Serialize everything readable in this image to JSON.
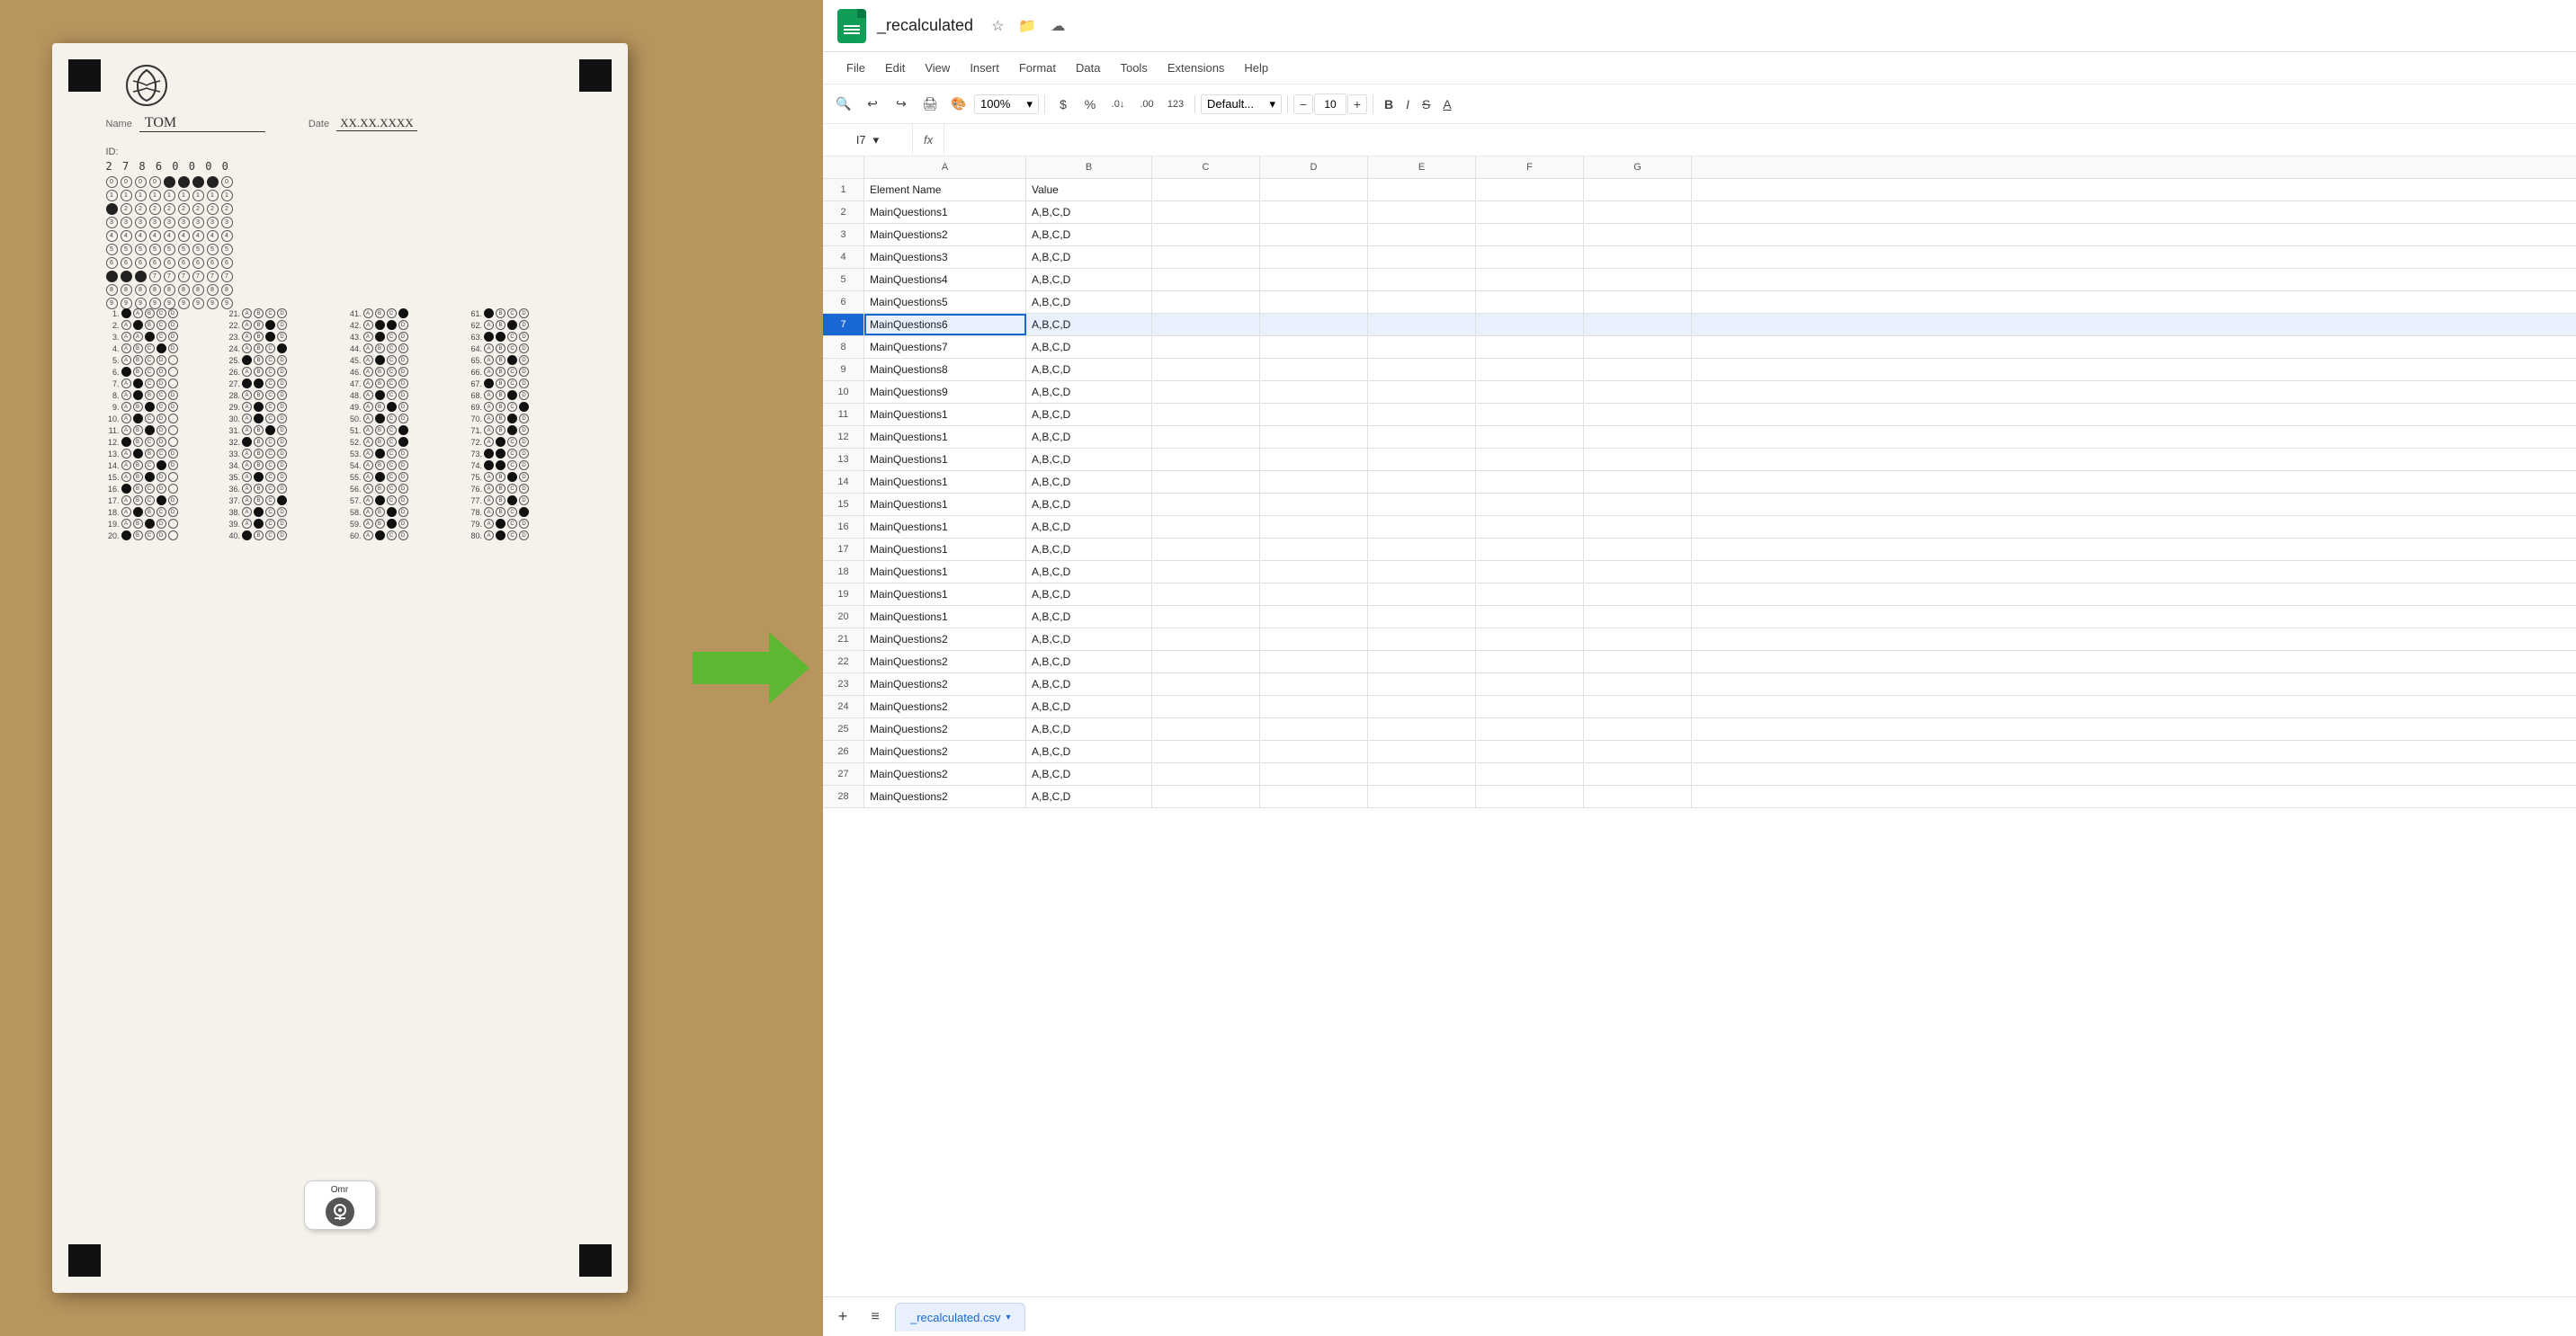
{
  "left": {
    "omr_name": "TOM",
    "omr_date": "XX.XX.XXXX",
    "omr_id": "2 7 8 6 0 0 0 0",
    "app_label": "Omr"
  },
  "spreadsheet": {
    "title": "_recalculated",
    "cell_ref": "I7",
    "formula": "",
    "zoom": "100%",
    "font": "Default...",
    "font_size": "10",
    "menu": [
      "File",
      "Edit",
      "View",
      "Insert",
      "Format",
      "Data",
      "Tools",
      "Extensions",
      "Help"
    ],
    "columns": [
      "A",
      "B",
      "C",
      "D",
      "E",
      "F",
      "G"
    ],
    "rows": [
      {
        "num": 1,
        "a": "Element Name",
        "b": "Value",
        "selected": false
      },
      {
        "num": 2,
        "a": "MainQuestions1",
        "b": "A,B,C,D",
        "selected": false
      },
      {
        "num": 3,
        "a": "MainQuestions2",
        "b": "A,B,C,D",
        "selected": false
      },
      {
        "num": 4,
        "a": "MainQuestions3",
        "b": "A,B,C,D",
        "selected": false
      },
      {
        "num": 5,
        "a": "MainQuestions4",
        "b": "A,B,C,D",
        "selected": false
      },
      {
        "num": 6,
        "a": "MainQuestions5",
        "b": "A,B,C,D",
        "selected": false
      },
      {
        "num": 7,
        "a": "MainQuestions6",
        "b": "A,B,C,D",
        "selected": true
      },
      {
        "num": 8,
        "a": "MainQuestions7",
        "b": "A,B,C,D",
        "selected": false
      },
      {
        "num": 9,
        "a": "MainQuestions8",
        "b": "A,B,C,D",
        "selected": false
      },
      {
        "num": 10,
        "a": "MainQuestions9",
        "b": "A,B,C,D",
        "selected": false
      },
      {
        "num": 11,
        "a": "MainQuestions1",
        "b": "A,B,C,D",
        "selected": false
      },
      {
        "num": 12,
        "a": "MainQuestions1",
        "b": "A,B,C,D",
        "selected": false
      },
      {
        "num": 13,
        "a": "MainQuestions1",
        "b": "A,B,C,D",
        "selected": false
      },
      {
        "num": 14,
        "a": "MainQuestions1",
        "b": "A,B,C,D",
        "selected": false
      },
      {
        "num": 15,
        "a": "MainQuestions1",
        "b": "A,B,C,D",
        "selected": false
      },
      {
        "num": 16,
        "a": "MainQuestions1",
        "b": "A,B,C,D",
        "selected": false
      },
      {
        "num": 17,
        "a": "MainQuestions1",
        "b": "A,B,C,D",
        "selected": false
      },
      {
        "num": 18,
        "a": "MainQuestions1",
        "b": "A,B,C,D",
        "selected": false
      },
      {
        "num": 19,
        "a": "MainQuestions1",
        "b": "A,B,C,D",
        "selected": false
      },
      {
        "num": 20,
        "a": "MainQuestions1",
        "b": "A,B,C,D",
        "selected": false
      },
      {
        "num": 21,
        "a": "MainQuestions2",
        "b": "A,B,C,D",
        "selected": false
      },
      {
        "num": 22,
        "a": "MainQuestions2",
        "b": "A,B,C,D",
        "selected": false
      },
      {
        "num": 23,
        "a": "MainQuestions2",
        "b": "A,B,C,D",
        "selected": false
      },
      {
        "num": 24,
        "a": "MainQuestions2",
        "b": "A,B,C,D",
        "selected": false
      },
      {
        "num": 25,
        "a": "MainQuestions2",
        "b": "A,B,C,D",
        "selected": false
      },
      {
        "num": 26,
        "a": "MainQuestions2",
        "b": "A,B,C,D",
        "selected": false
      },
      {
        "num": 27,
        "a": "MainQuestions2",
        "b": "A,B,C,D",
        "selected": false
      },
      {
        "num": 28,
        "a": "MainQuestions2",
        "b": "A,B,C,D",
        "selected": false
      }
    ],
    "sheet_tab": "_recalculated.csv"
  }
}
